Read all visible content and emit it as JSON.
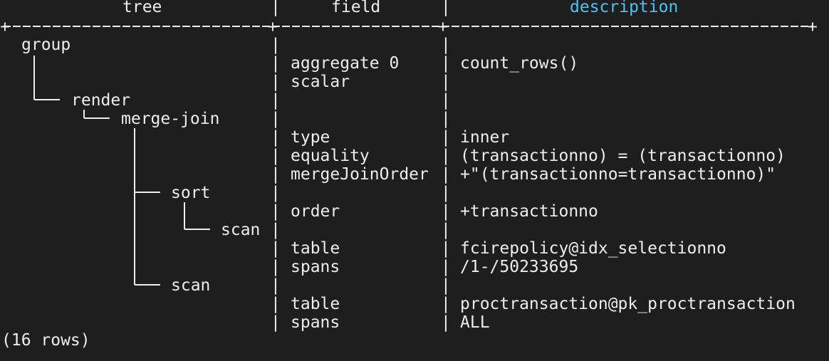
{
  "header": {
    "tree": "tree",
    "field": "field",
    "description": "description",
    "divider": "+--------------------------+--------------------------+------------------------------------------+",
    "colors": {
      "description": "#4fc3f7",
      "text": "#ededed",
      "background": "#1e1e1e"
    }
  },
  "tree_nodes": [
    {
      "label": "group"
    },
    {
      "label": "render"
    },
    {
      "label": "merge-join"
    },
    {
      "label": "sort"
    },
    {
      "label": "scan"
    },
    {
      "label": "scan"
    }
  ],
  "fields": [
    {
      "field": "aggregate 0",
      "description": "count_rows()"
    },
    {
      "field": "scalar",
      "description": ""
    },
    {
      "field": "type",
      "description": "inner"
    },
    {
      "field": "equality",
      "description": "(transactionno) = (transactionno)"
    },
    {
      "field": "mergeJoinOrder",
      "description": "+\"(transactionno=transactionno)\""
    },
    {
      "field": "order",
      "description": "+transactionno"
    },
    {
      "field": "table",
      "description": "fcirepolicy@idx_selectionno"
    },
    {
      "field": "spans",
      "description": "/1-/50233695"
    },
    {
      "field": "table",
      "description": "proctransaction@pk_proctransaction"
    },
    {
      "field": "spans",
      "description": "ALL"
    }
  ],
  "footer": "(16 rows)",
  "separator": "|"
}
